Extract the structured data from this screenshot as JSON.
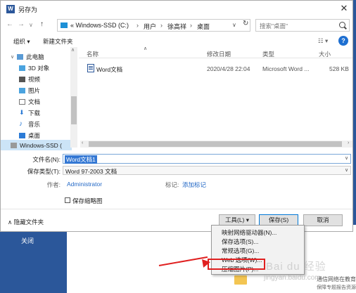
{
  "background": {
    "close_label": "关闭",
    "side_text": "通信网络在教育保障",
    "side_sub": "保障专题报告资源"
  },
  "title": "另存为",
  "title_icon": "W",
  "nav": {
    "back": "←",
    "forward": "→",
    "dropdown": "∨",
    "up": "↑"
  },
  "address": {
    "segments": [
      "« Windows-SSD (C:)",
      "用户",
      "徐高祥",
      "桌面"
    ],
    "separator": "›",
    "dropdown": "∨",
    "refresh": "↻"
  },
  "search": {
    "placeholder": "搜索\"桌面\""
  },
  "toolbar": {
    "organize": "组织 ▾",
    "new_folder": "新建文件夹",
    "view": "☷ ▾",
    "help": "?"
  },
  "sidebar": [
    {
      "label": "此电脑",
      "icon": "computer-icon",
      "color": "#5a9bd5"
    },
    {
      "label": "3D 对象",
      "icon": "cube-icon",
      "color": "#4aa3df"
    },
    {
      "label": "视频",
      "icon": "video-icon",
      "color": "#555555"
    },
    {
      "label": "图片",
      "icon": "picture-icon",
      "color": "#4aa3df"
    },
    {
      "label": "文档",
      "icon": "document-icon",
      "color": "#777777"
    },
    {
      "label": "下载",
      "icon": "download-icon",
      "color": "#2b7bd6"
    },
    {
      "label": "音乐",
      "icon": "music-icon",
      "color": "#2b7bd6"
    },
    {
      "label": "桌面",
      "icon": "desktop-icon",
      "color": "#2b7bd6"
    },
    {
      "label": "Windows-SSD (",
      "icon": "drive-icon",
      "color": "#888888"
    }
  ],
  "columns": [
    "名称",
    "修改日期",
    "类型",
    "大小"
  ],
  "files": [
    {
      "name": "Word文档",
      "modified": "2020/4/28 22:04",
      "type": "Microsoft Word ...",
      "size": "528 KB"
    }
  ],
  "form": {
    "filename_label": "文件名(N):",
    "filename_value": "Word文档1",
    "filetype_label": "保存类型(T):",
    "filetype_value": "Word 97-2003 文档",
    "author_label": "作者:",
    "author_value": "Administrator",
    "tags_label": "标记:",
    "tags_value": "添加标记",
    "thumbnail_label": "保存缩略图"
  },
  "buttons": {
    "hide_folders": "∧ 隐藏文件夹",
    "tools": "工具(L)  ▾",
    "save": "保存(S)",
    "cancel": "取消"
  },
  "tools_menu": [
    "映射网络驱动器(N)...",
    "保存选项(S)...",
    "常规选项(G)...",
    "Web 选项(W)...",
    "压缩图片(P)..."
  ],
  "watermark": "Bai du 经验",
  "watermark_sub": "jingyan.baidu.com"
}
